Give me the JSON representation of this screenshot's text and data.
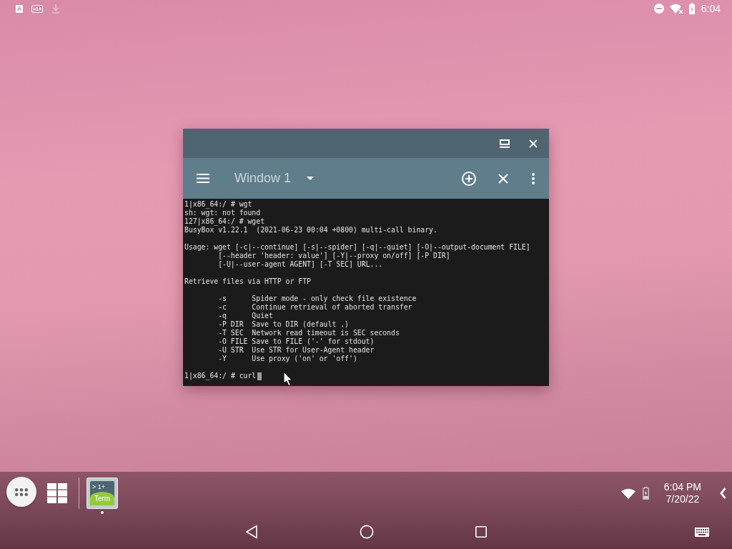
{
  "status_bar": {
    "notifications": [
      {
        "kind": "letter",
        "text": "A"
      },
      {
        "kind": "terminal",
        "text": ">1+"
      },
      {
        "kind": "download"
      }
    ],
    "wifi": {
      "no_internet": true
    },
    "battery": {
      "charging": true
    },
    "time": "6:04"
  },
  "terminal_window": {
    "toolbar": {
      "title": "Window 1"
    },
    "terminal": {
      "lines": [
        "1|x86_64:/ # wgt",
        "sh: wgt: not found",
        "127|x86_64:/ # wget",
        "BusyBox v1.22.1  (2021-06-23 00:04 +0800) multi-call binary."
      ],
      "usage": {
        "first": "Usage: wget [-c|--continue] [-s|--spider] [-q|--quiet] [-O|--output-document FILE]",
        "continued": [
          "[--header 'header: value'] [-Y|--proxy on/off] [-P DIR]",
          "[-U|--user-agent AGENT] [-T SEC] URL..."
        ]
      },
      "summary": "Retrieve files via HTTP or FTP",
      "options": [
        {
          "flag": "-s",
          "description": "Spider mode - only check file existence"
        },
        {
          "flag": "-c",
          "description": "Continue retrieval of aborted transfer"
        },
        {
          "flag": "-q",
          "description": "Quiet"
        },
        {
          "flag": "-P DIR",
          "description": "Save to DIR (default .)"
        },
        {
          "flag": "-T SEC",
          "description": "Network read timeout is SEC seconds"
        },
        {
          "flag": "-O FILE",
          "description": "Save to FILE ('-' for stdout)"
        },
        {
          "flag": "-U STR",
          "description": "Use STR for User-Agent header"
        },
        {
          "flag": "-Y",
          "description": "Use proxy ('on' or 'off')"
        }
      ],
      "prompt": "1|x86_64:/ # curl"
    }
  },
  "taskbar": {
    "apps": [
      {
        "top_text": "> 1+",
        "label": "Term",
        "running": true
      }
    ],
    "battery": {
      "charging": true
    },
    "clock": {
      "time": "6:04 PM",
      "date": "7/20/22"
    }
  }
}
